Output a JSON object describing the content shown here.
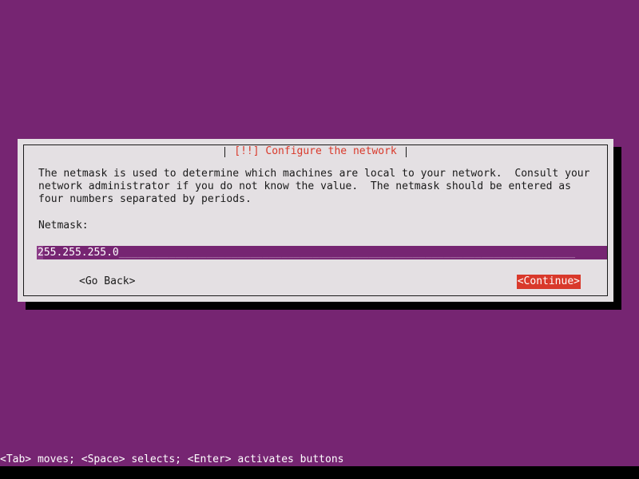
{
  "screen": {
    "background_color": "#762572",
    "bottom_bar_color": "#000000"
  },
  "dialog": {
    "title": "[!!] Configure the network",
    "title_color": "#d9392b",
    "background_color": "#e4e0e3",
    "border_color": "#1a1a1a",
    "shadow_color": "#000000",
    "body_lines": [
      "The netmask is used to determine which machines are local to your network.  Consult your",
      "network administrator if you do not know the value.  The netmask should be entered as",
      "four numbers separated by periods."
    ],
    "field_label": "Netmask:",
    "field": {
      "value": "255.255.255.0",
      "fill": "_________________________________________________________________________",
      "background_color": "#762572",
      "text_color": "#ffffff",
      "fill_color": "#c9a3c6",
      "cursor_color": "#8c3d88"
    },
    "buttons": [
      {
        "label": "<Go Back>",
        "selected": false,
        "text_color": "#1a1a1a",
        "background_color": "transparent"
      },
      {
        "label": "<Continue>",
        "selected": true,
        "text_color": "#ffffff",
        "background_color": "#d9392b"
      }
    ]
  },
  "status_bar": {
    "text": "<Tab> moves; <Space> selects; <Enter> activates buttons",
    "text_color": "#ffffff",
    "background_color": "#762572"
  }
}
